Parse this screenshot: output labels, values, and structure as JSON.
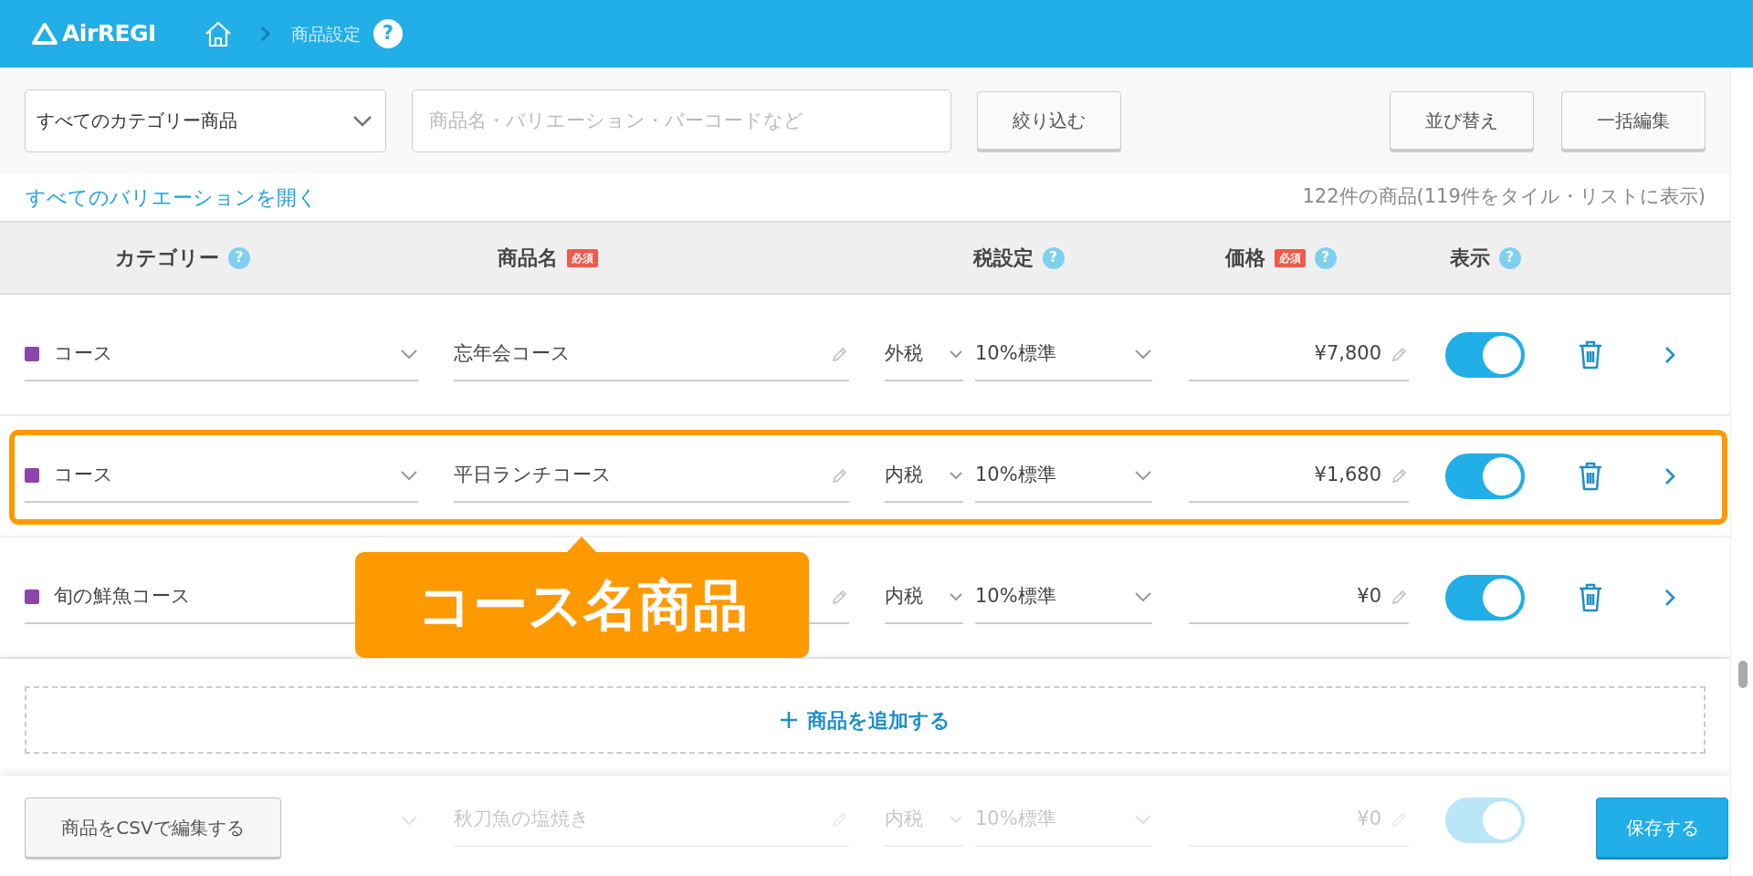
{
  "header": {
    "logo": "AirREGI",
    "breadcrumb": "商品設定",
    "help": "?"
  },
  "toolbar": {
    "category_select": "すべてのカテゴリー商品",
    "search": {
      "placeholder": "商品名・バリエーション・バーコードなど"
    },
    "filter_button": "絞り込む",
    "sort_button": "並び替え",
    "bulk_edit_button": "一括編集"
  },
  "expand_link": "すべてのバリエーションを開く",
  "count": "122件の商品(119件をタイル・リストに表示)",
  "columns": [
    {
      "label": "カテゴリー",
      "help": "?"
    },
    {
      "label": "商品名",
      "badge": "必須"
    },
    {
      "label": "税設定",
      "help": "?"
    },
    {
      "label": "価格",
      "badge": "必須",
      "help": "?"
    },
    {
      "label": "表示",
      "help": "?"
    }
  ],
  "rows": [
    {
      "category": "コース",
      "color": "#8e44ad",
      "name": "忘年会コース",
      "tax_type": "外税",
      "tax_rate": "10%標準",
      "price": "¥7,800",
      "on": true,
      "highlighted": false
    },
    {
      "category": "コース",
      "color": "#8e44ad",
      "name": "平日ランチコース",
      "tax_type": "内税",
      "tax_rate": "10%標準",
      "price": "¥1,680",
      "on": true,
      "highlighted": true
    },
    {
      "category": "旬の鮮魚コース",
      "color": "#8e44ad",
      "tax_type": "内税",
      "tax_rate": "10%標準",
      "price": "¥0",
      "on": true,
      "highlighted": false
    }
  ],
  "callout": "コース名商品",
  "add_button": "商品を追加する",
  "hidden_row": {
    "name": "秋刀魚の塩焼き",
    "tax_type": "内税",
    "tax_rate": "10%標準",
    "price": "¥0",
    "on": true
  },
  "footer": {
    "csv_button": "商品をCSVで編集する",
    "save_button": "保存する"
  }
}
